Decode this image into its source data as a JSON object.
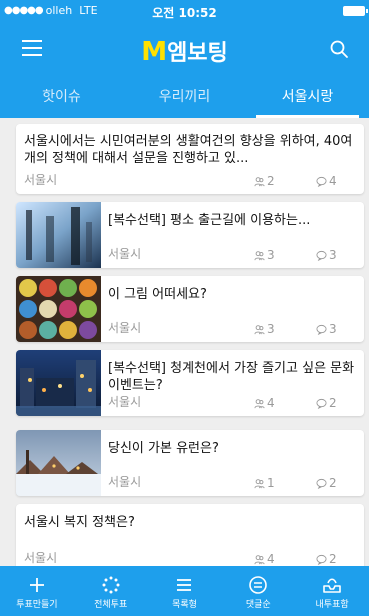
{
  "status": {
    "carrier": "olleh",
    "network": "LTE",
    "time": "오전 10:52"
  },
  "app": {
    "logo_letter": "M",
    "title_rest": "엠보팅"
  },
  "tabs": [
    {
      "label": "핫이슈"
    },
    {
      "label": "우리끼리"
    },
    {
      "label": "서울시랑"
    }
  ],
  "active_tab": "서울시랑",
  "cards": [
    {
      "title": "서울시에서는 시민여러분의 생활여건의 향상을 위하여, 40여개의 정책에 대해서 설문을 진행하고 있...",
      "source": "서울시",
      "participants": "2",
      "comments": "4"
    },
    {
      "title": "[복수선택] 평소 출근길에 이용하는...",
      "source": "서울시",
      "participants": "3",
      "comments": "3",
      "thumb": "commuters-photo"
    },
    {
      "title": "이 그림 어떠세요?",
      "source": "서울시",
      "participants": "3",
      "comments": "3",
      "thumb": "colorful-buttons-photo"
    },
    {
      "title": "[복수선택] 청계천에서 가장 즐기고 싶은 문화이벤트는?",
      "source": "서울시",
      "participants": "4",
      "comments": "2",
      "thumb": "cheonggyecheon-night-photo"
    },
    {
      "title": "당신이 가본 유런은?",
      "source": "서울시",
      "participants": "1",
      "comments": "2",
      "thumb": "winter-town-photo"
    },
    {
      "title": "서울시 복지 정책은?",
      "source": "서울시",
      "participants": "4",
      "comments": "2"
    }
  ],
  "bottom_nav": [
    {
      "label": "투표만들기",
      "icon": "plus-icon"
    },
    {
      "label": "전체투표",
      "icon": "dots-circle-icon"
    },
    {
      "label": "목록형",
      "icon": "list-icon"
    },
    {
      "label": "댓글순",
      "icon": "comment-icon"
    },
    {
      "label": "내투표함",
      "icon": "inbox-icon"
    }
  ],
  "colors": {
    "primary": "#1e9fec",
    "logo_accent": "#ffe100",
    "meta_text": "#9a9a9a",
    "background": "#eeeeee"
  }
}
